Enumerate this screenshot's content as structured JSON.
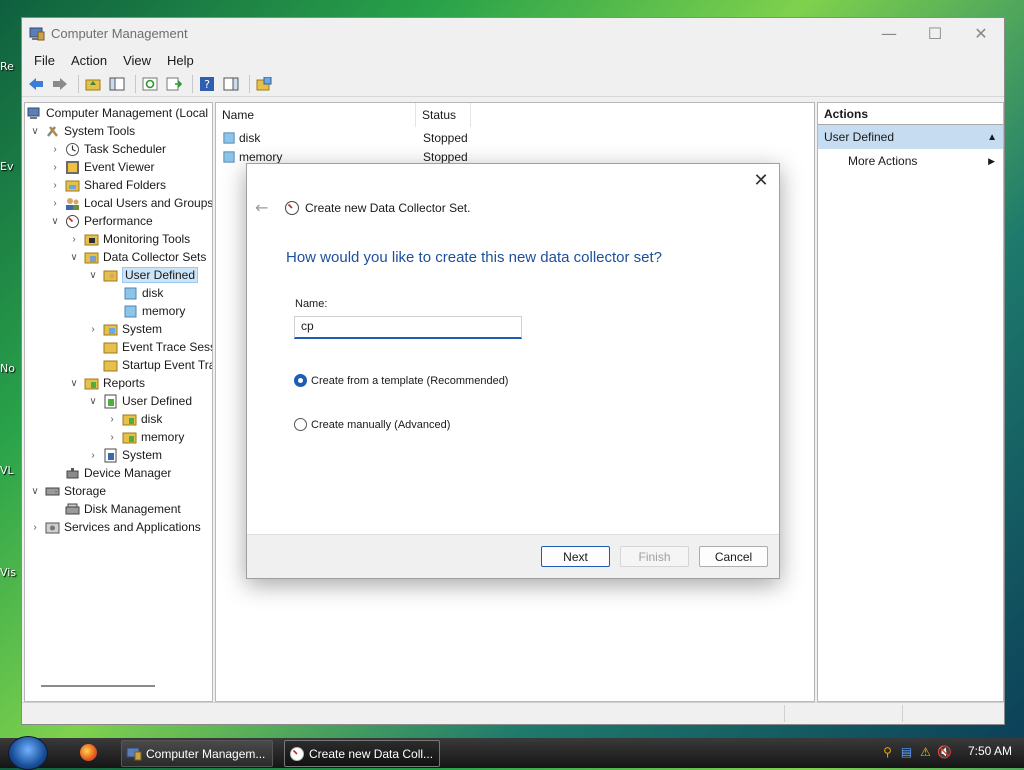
{
  "window": {
    "title": "Computer Management",
    "menu": [
      "File",
      "Action",
      "View",
      "Help"
    ]
  },
  "tree": {
    "items": [
      {
        "label": "Computer Management (Local"
      },
      {
        "label": "System Tools"
      },
      {
        "label": "Task Scheduler"
      },
      {
        "label": "Event Viewer"
      },
      {
        "label": "Shared Folders"
      },
      {
        "label": "Local Users and Groups"
      },
      {
        "label": "Performance"
      },
      {
        "label": "Monitoring Tools"
      },
      {
        "label": "Data Collector Sets"
      },
      {
        "label": "User Defined"
      },
      {
        "label": "disk"
      },
      {
        "label": "memory"
      },
      {
        "label": "System"
      },
      {
        "label": "Event Trace Sess"
      },
      {
        "label": "Startup Event Tra"
      },
      {
        "label": "Reports"
      },
      {
        "label": "User Defined"
      },
      {
        "label": "disk"
      },
      {
        "label": "memory"
      },
      {
        "label": "System"
      },
      {
        "label": "Device Manager"
      },
      {
        "label": "Storage"
      },
      {
        "label": "Disk Management"
      },
      {
        "label": "Services and Applications"
      }
    ]
  },
  "list": {
    "columns": [
      "Name",
      "Status"
    ],
    "rows": [
      {
        "name": "disk",
        "status": "Stopped"
      },
      {
        "name": "memory",
        "status": "Stopped"
      }
    ]
  },
  "actions": {
    "header": "Actions",
    "section": "User Defined",
    "items": [
      "More Actions"
    ]
  },
  "dialog": {
    "wizard_title": "Create new Data Collector Set.",
    "question": "How would you like to create this new data collector set?",
    "name_label": "Name:",
    "name_value": "cp",
    "option_template": "Create from a template (Recommended)",
    "option_manual": "Create manually (Advanced)",
    "selected_option": "template",
    "buttons": {
      "next": "Next",
      "finish": "Finish",
      "cancel": "Cancel"
    }
  },
  "taskbar": {
    "tasks": [
      "Computer Managem...",
      "Create new Data Coll..."
    ],
    "clock": "7:50 AM"
  },
  "desktop": {
    "stubs": [
      "Re",
      "Ev",
      "No",
      "VL",
      "Vis"
    ]
  },
  "colors": {
    "accent": "#1e5db4",
    "question_blue": "#1c4f9c",
    "selection": "#cce4f7",
    "actions_section": "#c5dcf1"
  }
}
